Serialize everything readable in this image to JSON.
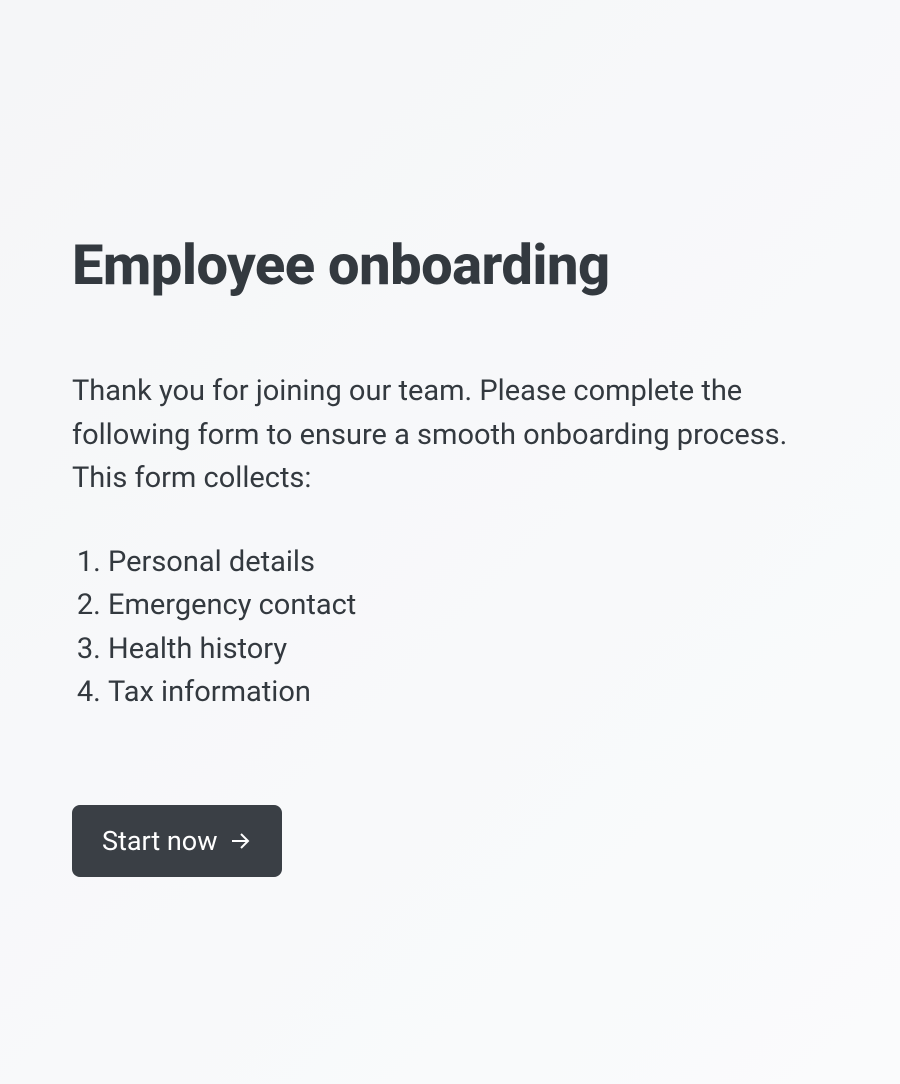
{
  "heading": "Employee onboarding",
  "intro": "Thank you for joining our team. Please complete the following form to ensure a smooth onboarding process. This form collects:",
  "list_items": [
    "Personal details",
    "Emergency contact",
    "Health history",
    "Tax information"
  ],
  "button": {
    "label": "Start now"
  }
}
